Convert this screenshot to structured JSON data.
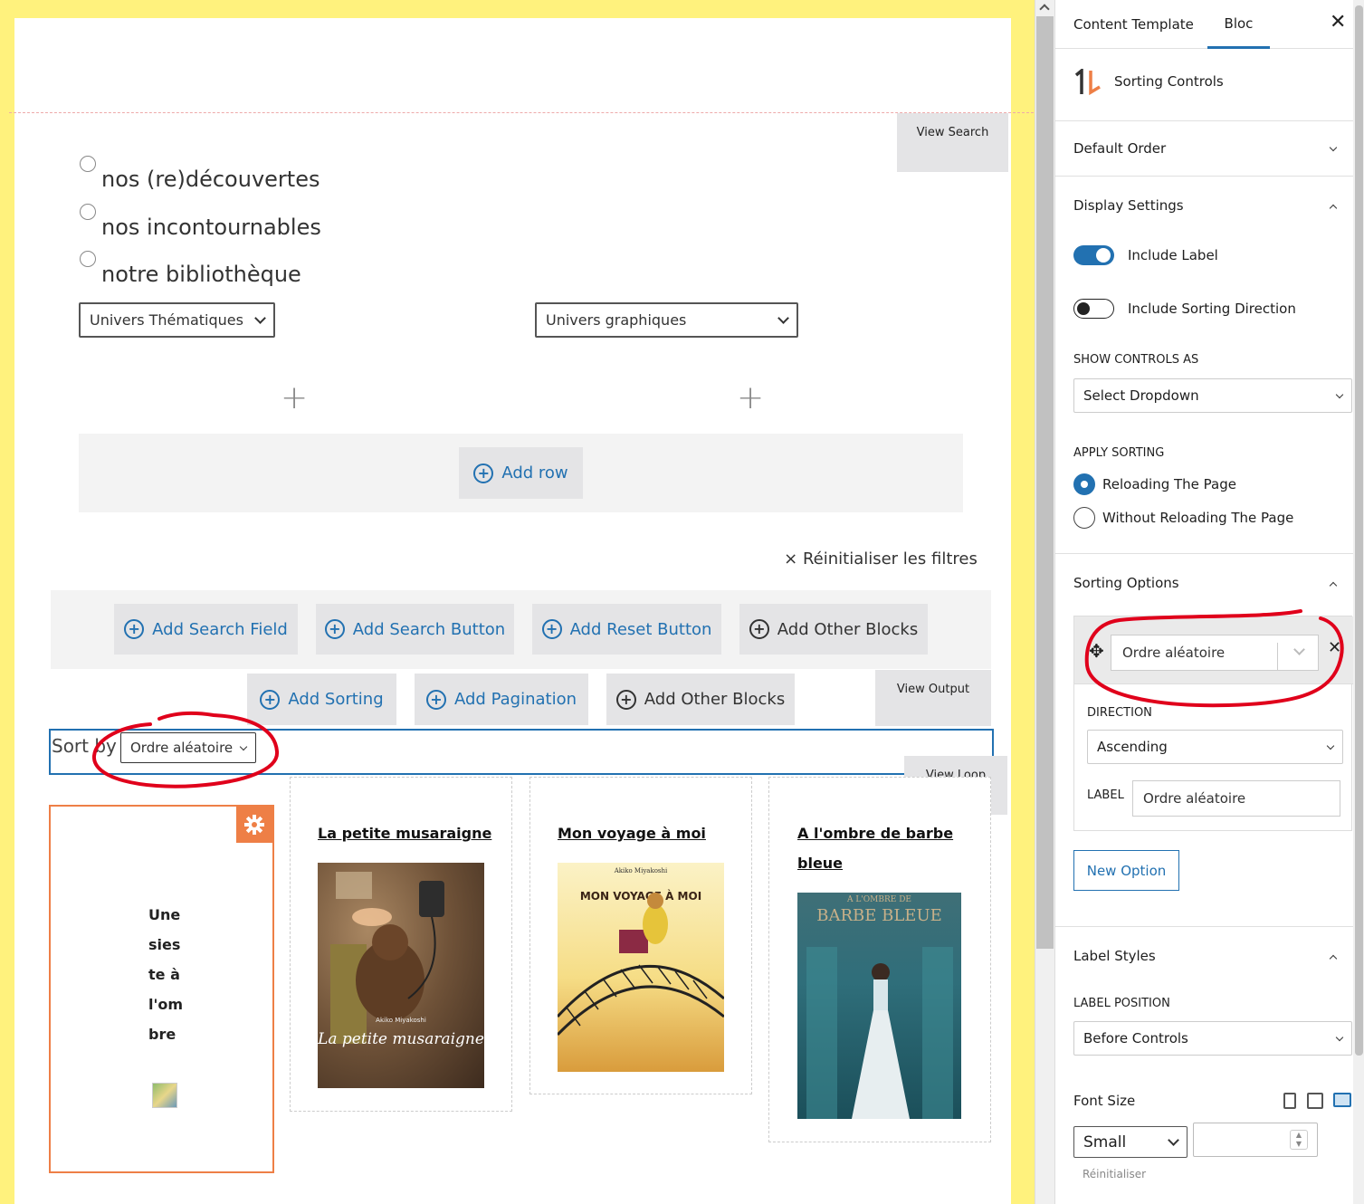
{
  "canvas": {
    "view_search_label": "View Search",
    "view_output_label": "View Output",
    "view_loop_label": "View Loop",
    "radio_options": [
      "nos (re)découvertes",
      "nos incontournables",
      "notre bibliothèque"
    ],
    "dropdown_thematiques": "Univers Thématiques",
    "dropdown_graphiques": "Univers graphiques",
    "add_row_label": "Add row",
    "reset_filters_label": "× Réinitialiser les filtres",
    "search_buttons": [
      "Add Search Field",
      "Add Search Button",
      "Add Reset Button",
      "Add Other Blocks"
    ],
    "output_buttons": [
      "Add Sorting",
      "Add Pagination",
      "Add Other Blocks"
    ],
    "sort_label": "Sort by",
    "sort_value": "Ordre aléatoire",
    "annotation_color": "#e0001b",
    "card1_lines": [
      "Une",
      "sies",
      "te à",
      "l'om",
      "bre"
    ],
    "books": [
      {
        "title": "La petite musaraigne",
        "cover_text": "La petite musaraigne",
        "cover_author": "Akiko Miyakoshi"
      },
      {
        "title": "Mon voyage à moi",
        "cover_text": "MON VOYAGE À MOI",
        "cover_author": "Akiko Miyakoshi"
      },
      {
        "title_line1": "A l'ombre de barbe",
        "title_line2": "bleue",
        "cover_text_1": "A L'OMBRE DE",
        "cover_text_2": "BARBE BLEUE"
      }
    ]
  },
  "sidebar": {
    "tab_content_template": "Content Template",
    "tab_bloc": "Bloc",
    "block_name": "Sorting Controls",
    "panels": {
      "default_order": "Default Order",
      "display_settings": "Display Settings",
      "sorting_options": "Sorting Options",
      "label_styles": "Label Styles"
    },
    "include_label": "Include Label",
    "include_sorting_direction": "Include Sorting Direction",
    "show_controls_as_label": "SHOW CONTROLS AS",
    "show_controls_as_value": "Select Dropdown",
    "apply_sorting_label": "APPLY SORTING",
    "apply_options": [
      "Reloading The Page",
      "Without Reloading The Page"
    ],
    "option_value": "Ordre aléatoire",
    "direction_label": "DIRECTION",
    "direction_value": "Ascending",
    "label_label": "LABEL",
    "label_value": "Ordre aléatoire",
    "new_option": "New Option",
    "label_position_label": "LABEL POSITION",
    "label_position_value": "Before Controls",
    "font_size_label": "Font Size",
    "font_size_value": "Small",
    "reset_label": "Réinitialiser",
    "accent_color": "#2271b1",
    "orange_color": "#ee7f46"
  }
}
